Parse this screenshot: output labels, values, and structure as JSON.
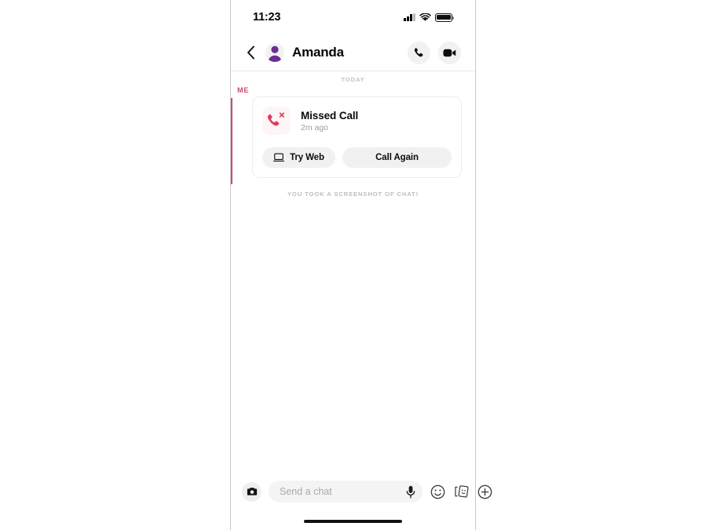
{
  "status_bar": {
    "time": "11:23",
    "signal_icon": "signal-bars-icon",
    "wifi_icon": "wifi-icon",
    "battery_icon": "battery-icon"
  },
  "header": {
    "back_icon": "chevron-left-icon",
    "avatar_icon": "bitmoji-avatar-icon",
    "contact_name": "Amanda",
    "phone_icon": "phone-icon",
    "video_icon": "video-camera-icon"
  },
  "conversation": {
    "day_divider": "TODAY",
    "sender_label": "ME",
    "missed_call": {
      "icon": "missed-call-icon",
      "title": "Missed Call",
      "timestamp": "2m ago",
      "try_web_label": "Try Web",
      "try_web_icon": "laptop-icon",
      "call_again_label": "Call Again"
    },
    "screenshot_notice": "YOU TOOK A SCREENSHOT OF CHAT!"
  },
  "composer": {
    "camera_icon": "camera-icon",
    "input_value": "",
    "input_placeholder": "Send a chat",
    "mic_icon": "microphone-icon",
    "emoji_icon": "smiley-face-icon",
    "sticker_icon": "sticker-cards-icon",
    "add_icon": "plus-circle-icon"
  },
  "colors": {
    "accent_red": "#cf4b69",
    "avatar_purple": "#6b2d90",
    "missed_call_red": "#e23c5a",
    "pill_gray": "#f1f1f1"
  }
}
